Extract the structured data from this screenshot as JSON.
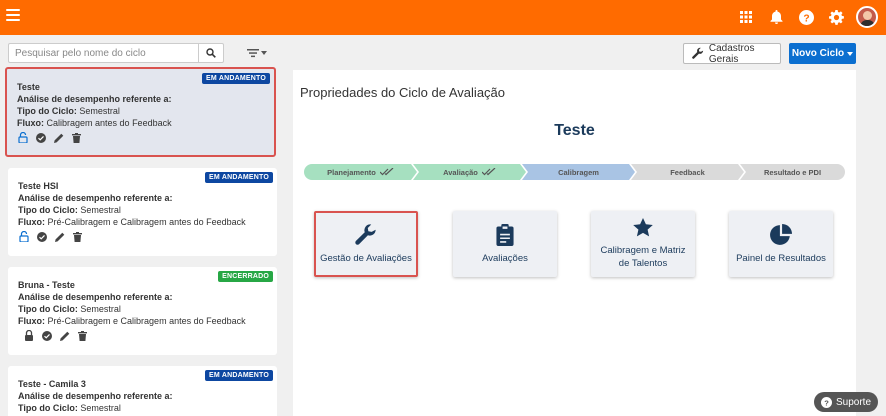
{
  "colors": {
    "topbar": "#ff6b00",
    "primary": "#0b6fd0",
    "badge_andamento": "#0d47a1",
    "badge_encerrado": "#27a745",
    "step_done": "#a6e0c0",
    "step_current": "#a9c4e4",
    "step_todo": "#dadada",
    "highlight": "#d9534f"
  },
  "topbar": {
    "icons": [
      "menu-icon",
      "apps-grid-icon",
      "bell-icon",
      "help-icon",
      "gear-icon",
      "user-avatar"
    ]
  },
  "search": {
    "placeholder": "Pesquisar pelo nome do ciclo",
    "value": ""
  },
  "cycles": [
    {
      "title": "Teste",
      "badge": "EM ANDAMENTO",
      "l1": "Análise de desempenho referente a:",
      "l2_label": "Tipo do Ciclo:",
      "l2_value": "Semestral",
      "l3_label": "Fluxo:",
      "l3_value": "Calibragem antes do Feedback"
    },
    {
      "title": "Teste HSI",
      "badge": "EM ANDAMENTO",
      "l1": "Análise de desempenho referente a:",
      "l2_label": "Tipo do Ciclo:",
      "l2_value": "Semestral",
      "l3_label": "Fluxo:",
      "l3_value": "Pré-Calibragem e Calibragem antes do Feedback"
    },
    {
      "title": "Bruna - Teste",
      "badge": "ENCERRADO",
      "l1": "Análise de desempenho referente a:",
      "l2_label": "Tipo do Ciclo:",
      "l2_value": "Semestral",
      "l3_label": "Fluxo:",
      "l3_value": "Pré-Calibragem e Calibragem antes do Feedback"
    },
    {
      "title": "Teste - Camila 3",
      "badge": "EM ANDAMENTO",
      "l1": "Análise de desempenho referente a:",
      "l2_label": "Tipo do Ciclo:",
      "l2_value": "Semestral"
    }
  ],
  "toolbar": {
    "cadastros": "Cadastros Gerais",
    "novo": "Novo Ciclo"
  },
  "panel": {
    "title": "Propriedades do Ciclo de Avaliação",
    "cycle_name": "Teste",
    "steps": [
      {
        "label": "Planejamento",
        "state": "done"
      },
      {
        "label": "Avaliação",
        "state": "done"
      },
      {
        "label": "Calibragem",
        "state": "current"
      },
      {
        "label": "Feedback",
        "state": "todo"
      },
      {
        "label": "Resultado e PDI",
        "state": "todo"
      }
    ],
    "tiles": [
      {
        "label": "Gestão de Avaliações",
        "icon": "wrench-icon"
      },
      {
        "label": "Avaliações",
        "icon": "clipboard-icon"
      },
      {
        "label": "Calibragem e Matriz de Talentos",
        "icon": "star-icon"
      },
      {
        "label": "Painel de Resultados",
        "icon": "pie-chart-icon"
      }
    ]
  },
  "support": {
    "label": "Suporte"
  }
}
